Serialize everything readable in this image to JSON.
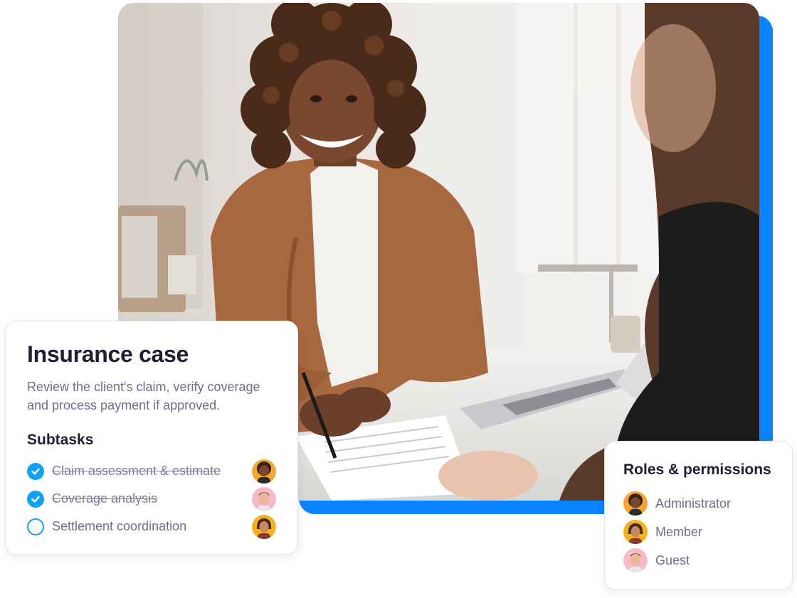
{
  "case_card": {
    "title": "Insurance case",
    "description": "Review the client's claim, verify coverage and process payment if approved.",
    "subtasks_heading": "Subtasks",
    "subtasks": [
      {
        "label": "Claim assessment & estimate",
        "status": "done",
        "avatar": "woman-curly-hair-avatar"
      },
      {
        "label": "Coverage analysis",
        "status": "done",
        "avatar": "man-avatar"
      },
      {
        "label": "Settlement coordination",
        "status": "open",
        "avatar": "woman-avatar"
      }
    ]
  },
  "roles_card": {
    "title": "Roles & permissions",
    "roles": [
      {
        "label": "Administrator",
        "avatar": "woman-curly-hair-avatar"
      },
      {
        "label": "Member",
        "avatar": "woman-avatar"
      },
      {
        "label": "Guest",
        "avatar": "man-avatar"
      }
    ]
  },
  "colors": {
    "accent_blue": "#0a85ff",
    "check_blue": "#0ea2f0",
    "heading_text": "#1f1f33",
    "muted_text": "#6e6f84",
    "card_border": "#e3e3ea"
  }
}
